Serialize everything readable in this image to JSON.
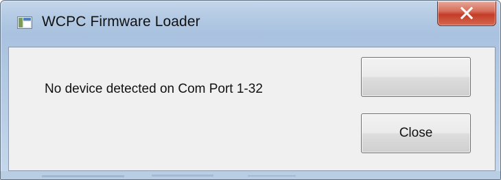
{
  "window": {
    "title": "WCPC Firmware Loader",
    "icon": "application-window-icon",
    "close_icon": "close-x-icon"
  },
  "dialog": {
    "message": "No device detected on Com Port 1-32",
    "blank_button_label": "",
    "close_button_label": "Close"
  },
  "colors": {
    "frame": "#b5cbe4",
    "client": "#f0f0f0",
    "close_button": "#c33d28"
  }
}
